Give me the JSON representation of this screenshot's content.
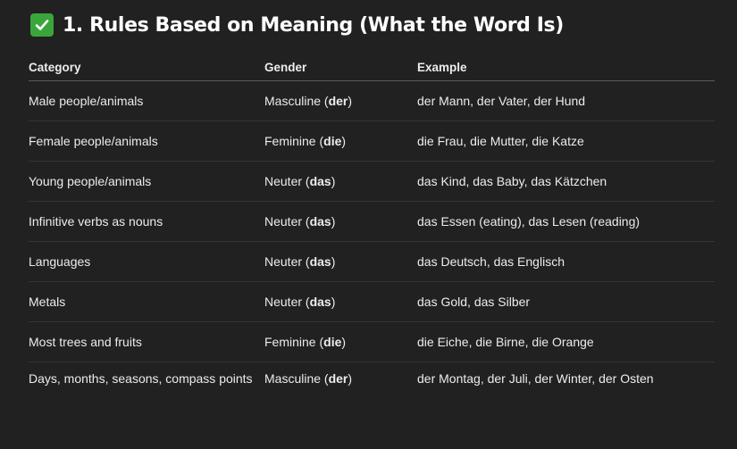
{
  "heading": {
    "icon": "check-mark-icon",
    "title": "1. Rules Based on Meaning (What the Word Is)"
  },
  "table": {
    "headers": [
      "Category",
      "Gender",
      "Example"
    ],
    "rows": [
      {
        "category": "Male people/animals",
        "gender": "Masculine",
        "article": "der",
        "example": "der Mann, der Vater, der Hund"
      },
      {
        "category": "Female people/animals",
        "gender": "Feminine",
        "article": "die",
        "example": "die Frau, die Mutter, die Katze"
      },
      {
        "category": "Young people/animals",
        "gender": "Neuter",
        "article": "das",
        "example": "das Kind, das Baby, das Kätzchen"
      },
      {
        "category": "Infinitive verbs as nouns",
        "gender": "Neuter",
        "article": "das",
        "example": "das Essen (eating), das Lesen (reading)"
      },
      {
        "category": "Languages",
        "gender": "Neuter",
        "article": "das",
        "example": "das Deutsch, das Englisch"
      },
      {
        "category": "Metals",
        "gender": "Neuter",
        "article": "das",
        "example": "das Gold, das Silber"
      },
      {
        "category": "Most trees and fruits",
        "gender": "Feminine",
        "article": "die",
        "example": "die Eiche, die Birne, die Orange"
      },
      {
        "category": "Days, months, seasons, compass points",
        "gender": "Masculine",
        "article": "der",
        "example": "der Montag, der Juli, der Winter, der Osten"
      }
    ]
  },
  "colors": {
    "background": "#212121",
    "text": "#ececec",
    "check_green": "#3aa53a"
  }
}
